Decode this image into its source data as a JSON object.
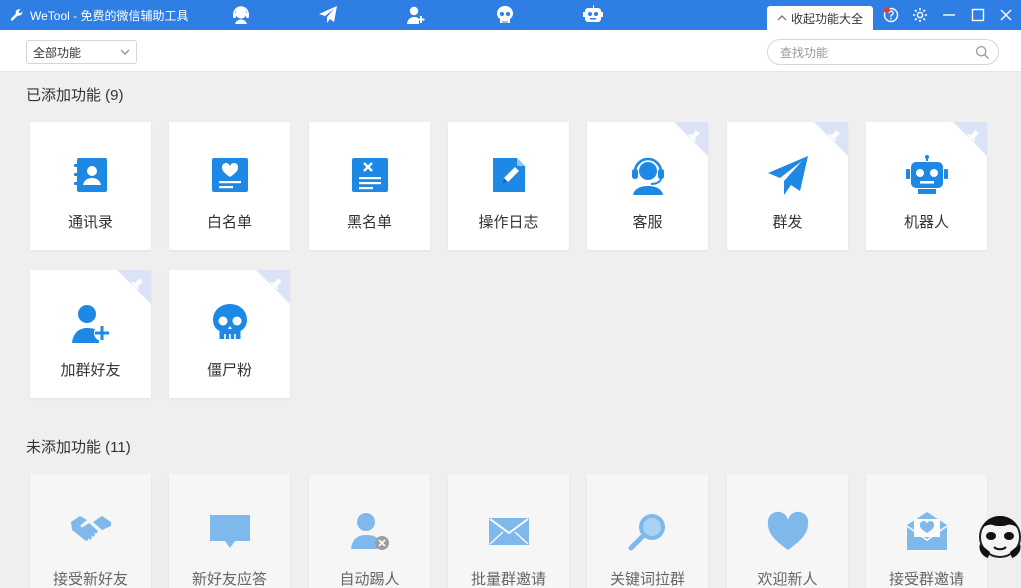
{
  "app": {
    "title": "WeTool - 免费的微信辅助工具",
    "collapse_label": "收起功能大全"
  },
  "filter": {
    "selected": "全部功能",
    "search_placeholder": "查找功能"
  },
  "added_section": {
    "title": "已添加功能 (9)",
    "items": [
      {
        "label": "通讯录",
        "icon": "contacts-icon",
        "pinned": false
      },
      {
        "label": "白名单",
        "icon": "whitelist-icon",
        "pinned": false
      },
      {
        "label": "黑名单",
        "icon": "blacklist-icon",
        "pinned": false
      },
      {
        "label": "操作日志",
        "icon": "operation-log-icon",
        "pinned": false
      },
      {
        "label": "客服",
        "icon": "customer-service-icon",
        "pinned": true
      },
      {
        "label": "群发",
        "icon": "paper-plane-icon",
        "pinned": true
      },
      {
        "label": "机器人",
        "icon": "robot-icon",
        "pinned": true
      },
      {
        "label": "加群好友",
        "icon": "add-friend-icon",
        "pinned": true
      },
      {
        "label": "僵尸粉",
        "icon": "skull-icon",
        "pinned": true
      }
    ]
  },
  "not_added_section": {
    "title": "未添加功能 (11)",
    "items": [
      {
        "label": "接受新好友",
        "icon": "handshake-icon"
      },
      {
        "label": "新好友应答",
        "icon": "chat-bubble-icon"
      },
      {
        "label": "自动踢人",
        "icon": "remove-user-icon"
      },
      {
        "label": "批量群邀请",
        "icon": "envelope-icon"
      },
      {
        "label": "关键词拉群",
        "icon": "magnifier-icon"
      },
      {
        "label": "欢迎新人",
        "icon": "heart-icon"
      },
      {
        "label": "接受群邀请",
        "icon": "envelope-heart-icon"
      }
    ]
  },
  "colors": {
    "titlebar": "#2f7ee3",
    "icon_blue": "#1e88e5",
    "pin_bg": "#dce3f7"
  }
}
